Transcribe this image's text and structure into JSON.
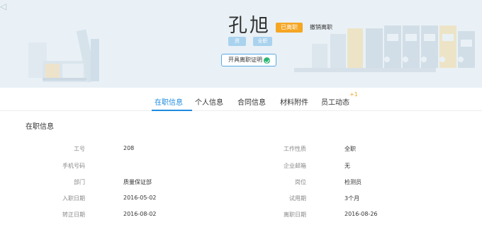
{
  "header": {
    "back_text": "◁",
    "employee_name": "孔旭",
    "status_badge": "已离职",
    "revoke_link": "撤销离职",
    "tags": [
      "资",
      "全职"
    ],
    "certificate_button": "开具离职证明"
  },
  "tabs": [
    {
      "label": "在职信息",
      "active": true
    },
    {
      "label": "个人信息",
      "active": false
    },
    {
      "label": "合同信息",
      "active": false
    },
    {
      "label": "材料附件",
      "active": false
    },
    {
      "label": "员工动态",
      "active": false
    }
  ],
  "tab_badge": "+1",
  "section_title": "在职信息",
  "fields_left": [
    {
      "label": "工号",
      "value": "208"
    },
    {
      "label": "手机号码",
      "value": ""
    },
    {
      "label": "部门",
      "value": "质量保证部"
    },
    {
      "label": "入职日期",
      "value": "2016-05-02"
    },
    {
      "label": "转正日期",
      "value": "2016-08-02"
    }
  ],
  "fields_right": [
    {
      "label": "工作性质",
      "value": "全职"
    },
    {
      "label": "企业邮箱",
      "value": "无"
    },
    {
      "label": "岗位",
      "value": "检测员"
    },
    {
      "label": "试用期",
      "value": "3个月"
    },
    {
      "label": "离职日期",
      "value": "2016-08-26"
    }
  ],
  "colors": {
    "accent": "#1e8be0",
    "badge_orange": "#f5a623",
    "tag_blue": "#a9d2ee",
    "header_bg": "#e9f1f6",
    "check_green": "#2bb673"
  }
}
